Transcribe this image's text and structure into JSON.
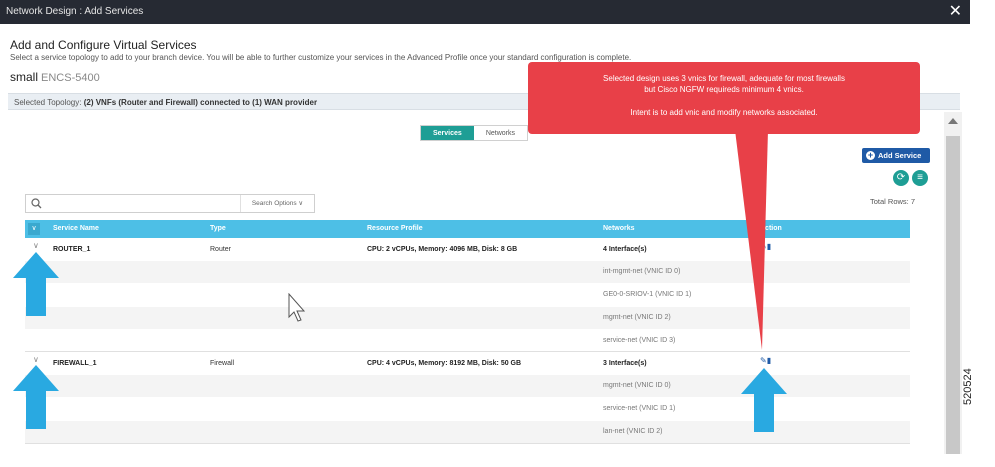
{
  "window": {
    "title": "Network Design : Add Services",
    "close_glyph": "✕"
  },
  "header": {
    "title": "Add and Configure Virtual Services",
    "subtitle": "Select a service topology to add to your branch device. You will be able to further customize your services in the Advanced Profile once your standard configuration is complete.",
    "device_size": "small",
    "device_model": "ENCS-5400"
  },
  "topology": {
    "label": "Selected Topology:",
    "value": "(2) VNFs (Router and Firewall) connected to (1) WAN provider"
  },
  "tabs": [
    {
      "label": "Services",
      "active": true
    },
    {
      "label": "Networks",
      "active": false
    }
  ],
  "toolbar": {
    "add_service_label": "Add Service",
    "search_placeholder": "",
    "search_options_label": "Search Options  ∨",
    "total_rows_label": "Total Rows: 7"
  },
  "table": {
    "columns": [
      "Service Name",
      "Type",
      "Resource Profile",
      "Networks",
      "Action"
    ],
    "rows": [
      {
        "name": "ROUTER_1",
        "type": "Router",
        "profile": "CPU: 2 vCPUs, Memory: 4096 MB, Disk: 8 GB",
        "networks": "4 Interface(s)",
        "sub": [
          "int-mgmt-net (VNIC ID 0)",
          "GE0-0-SRIOV-1 (VNIC ID 1)",
          "mgmt-net (VNIC ID 2)",
          "service-net (VNIC ID 3)"
        ]
      },
      {
        "name": "FIREWALL_1",
        "type": "Firewall",
        "profile": "CPU: 4 vCPUs, Memory: 8192 MB, Disk: 50 GB",
        "networks": "3 Interface(s)",
        "sub": [
          "mgmt-net (VNIC ID 0)",
          "service-net (VNIC ID 1)",
          "lan-net (VNIC ID 2)"
        ]
      }
    ]
  },
  "annotation": {
    "line1": "Selected design uses 3 vnics for firewall, adequate for most firewalls",
    "line2": "but Cisco NGFW requireds minimum 4 vnics.",
    "line3": "Intent is to add vnic and modify networks associated."
  },
  "figure_number": "520524",
  "colors": {
    "accent": "#1e9e95",
    "table_header": "#4dbfe6",
    "callout": "#e84048",
    "arrow": "#29a9e1",
    "titlebar": "#262a33"
  }
}
